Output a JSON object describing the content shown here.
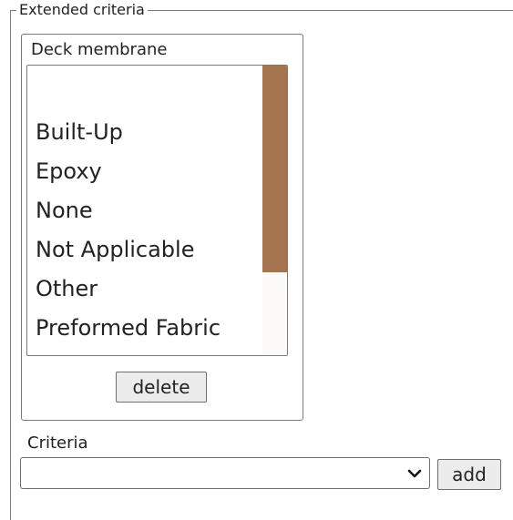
{
  "extended_criteria": {
    "legend": "Extended criteria",
    "deck_membrane": {
      "title": "Deck membrane",
      "options": [
        "",
        "Built-Up",
        "Epoxy",
        "None",
        "Not Applicable",
        "Other",
        "Preformed Fabric"
      ],
      "scroll_position": 0.0
    },
    "delete_label": "delete",
    "criteria": {
      "label": "Criteria",
      "selected_value": ""
    },
    "add_label": "add"
  },
  "colors": {
    "scroll_thumb": "#a6754f",
    "border": "#7a7a7a",
    "button_bg": "#ececec"
  }
}
